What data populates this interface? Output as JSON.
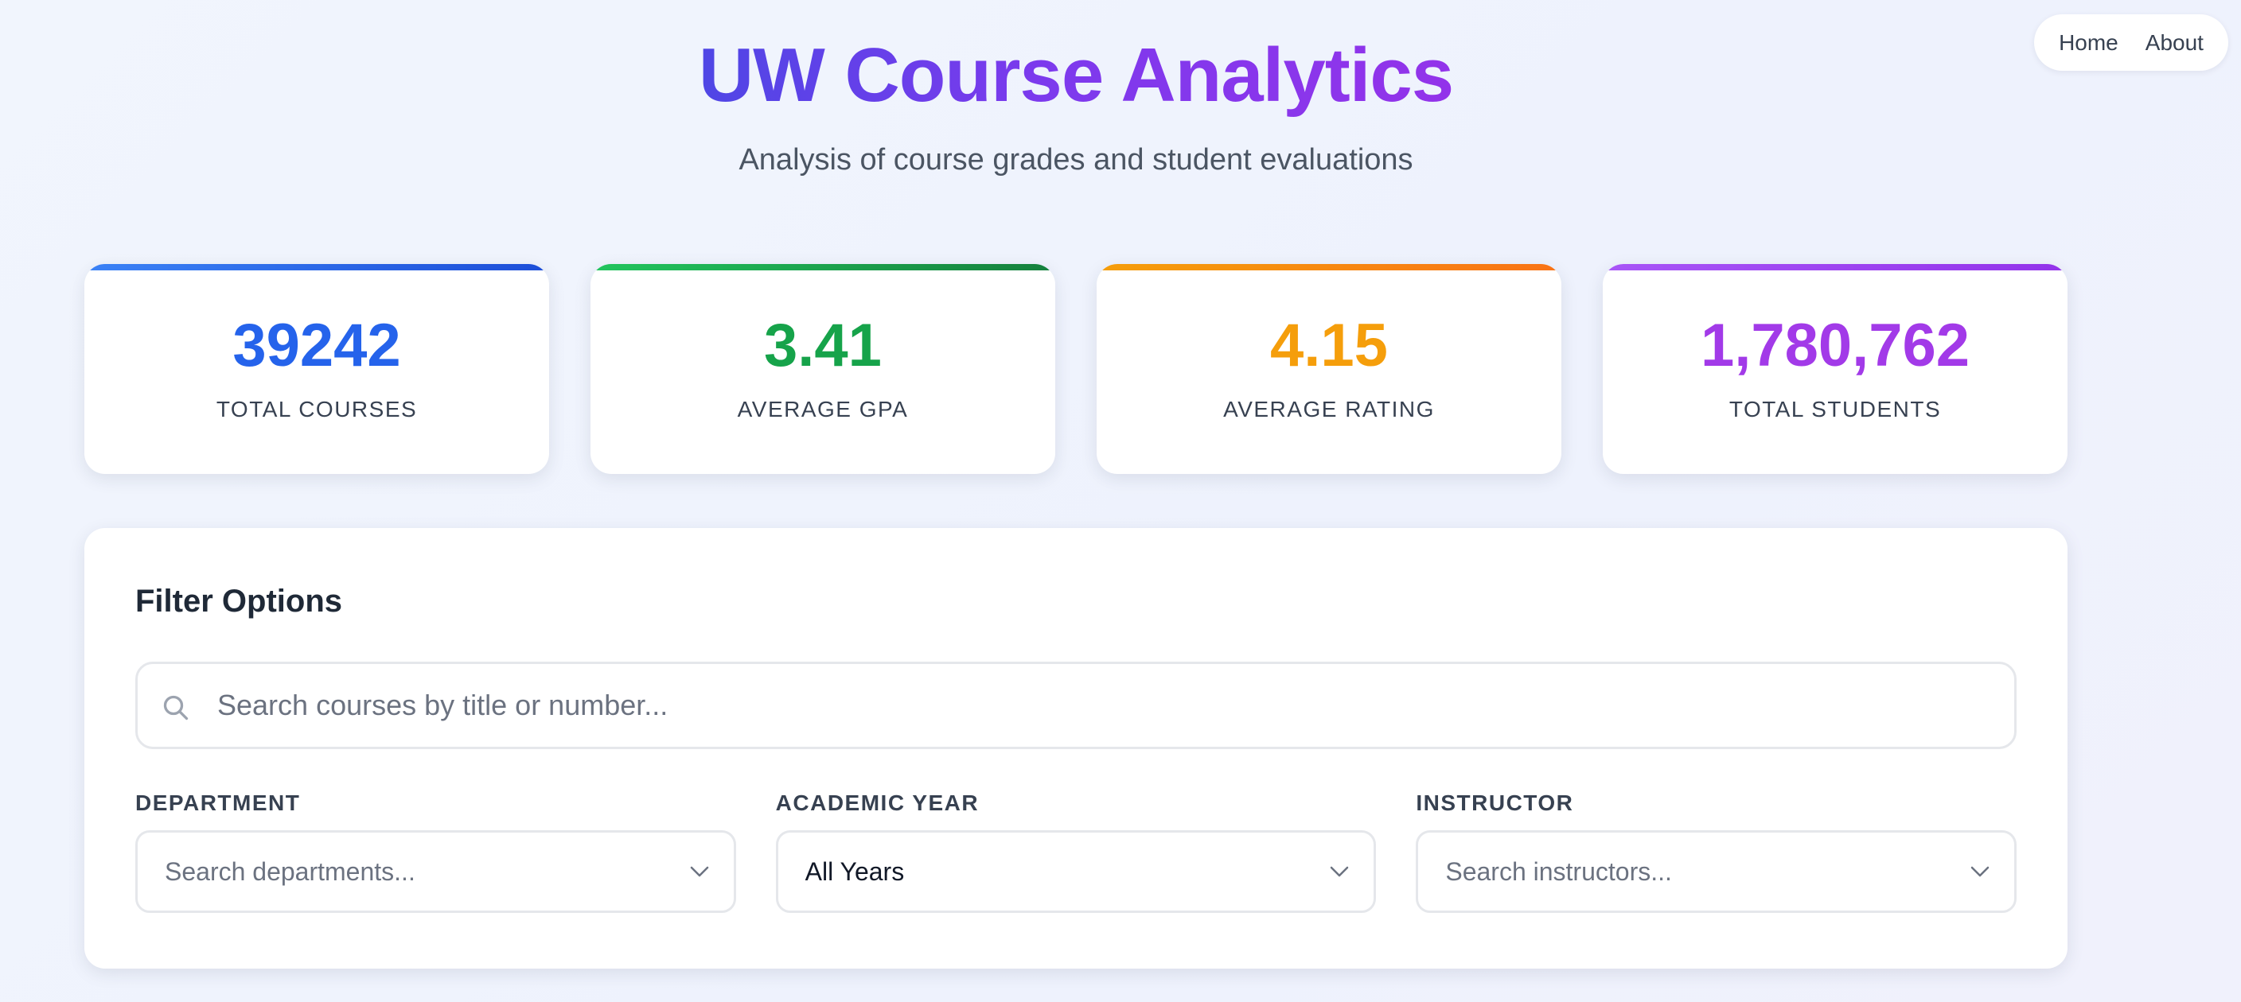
{
  "nav": {
    "home": "Home",
    "about": "About"
  },
  "header": {
    "title": "UW Course Analytics",
    "subtitle": "Analysis of course grades and student evaluations"
  },
  "stats": [
    {
      "value": "39242",
      "label": "TOTAL COURSES",
      "color": "#2563eb"
    },
    {
      "value": "3.41",
      "label": "AVERAGE GPA",
      "color": "#16a34a"
    },
    {
      "value": "4.15",
      "label": "AVERAGE RATING",
      "color": "#f59e0b"
    },
    {
      "value": "1,780,762",
      "label": "TOTAL STUDENTS",
      "color": "#a23ae8"
    }
  ],
  "filters": {
    "title": "Filter Options",
    "search_placeholder": "Search courses by title or number...",
    "search_icon": "search-icon",
    "department": {
      "label": "DEPARTMENT",
      "placeholder": "Search departments..."
    },
    "year": {
      "label": "ACADEMIC YEAR",
      "selected": "All Years"
    },
    "instructor": {
      "label": "INSTRUCTOR",
      "placeholder": "Search instructors..."
    }
  },
  "colors": {
    "accent": "#6d3aed"
  }
}
